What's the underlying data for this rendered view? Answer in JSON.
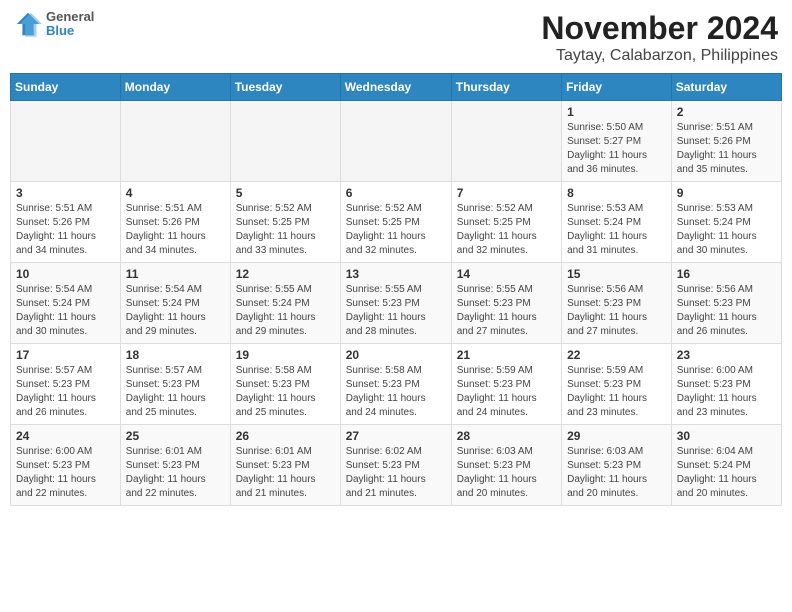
{
  "header": {
    "logo_line1": "General",
    "logo_line2": "Blue",
    "title": "November 2024",
    "subtitle": "Taytay, Calabarzon, Philippines"
  },
  "weekdays": [
    "Sunday",
    "Monday",
    "Tuesday",
    "Wednesday",
    "Thursday",
    "Friday",
    "Saturday"
  ],
  "weeks": [
    [
      {
        "day": "",
        "info": ""
      },
      {
        "day": "",
        "info": ""
      },
      {
        "day": "",
        "info": ""
      },
      {
        "day": "",
        "info": ""
      },
      {
        "day": "",
        "info": ""
      },
      {
        "day": "1",
        "info": "Sunrise: 5:50 AM\nSunset: 5:27 PM\nDaylight: 11 hours\nand 36 minutes."
      },
      {
        "day": "2",
        "info": "Sunrise: 5:51 AM\nSunset: 5:26 PM\nDaylight: 11 hours\nand 35 minutes."
      }
    ],
    [
      {
        "day": "3",
        "info": "Sunrise: 5:51 AM\nSunset: 5:26 PM\nDaylight: 11 hours\nand 34 minutes."
      },
      {
        "day": "4",
        "info": "Sunrise: 5:51 AM\nSunset: 5:26 PM\nDaylight: 11 hours\nand 34 minutes."
      },
      {
        "day": "5",
        "info": "Sunrise: 5:52 AM\nSunset: 5:25 PM\nDaylight: 11 hours\nand 33 minutes."
      },
      {
        "day": "6",
        "info": "Sunrise: 5:52 AM\nSunset: 5:25 PM\nDaylight: 11 hours\nand 32 minutes."
      },
      {
        "day": "7",
        "info": "Sunrise: 5:52 AM\nSunset: 5:25 PM\nDaylight: 11 hours\nand 32 minutes."
      },
      {
        "day": "8",
        "info": "Sunrise: 5:53 AM\nSunset: 5:24 PM\nDaylight: 11 hours\nand 31 minutes."
      },
      {
        "day": "9",
        "info": "Sunrise: 5:53 AM\nSunset: 5:24 PM\nDaylight: 11 hours\nand 30 minutes."
      }
    ],
    [
      {
        "day": "10",
        "info": "Sunrise: 5:54 AM\nSunset: 5:24 PM\nDaylight: 11 hours\nand 30 minutes."
      },
      {
        "day": "11",
        "info": "Sunrise: 5:54 AM\nSunset: 5:24 PM\nDaylight: 11 hours\nand 29 minutes."
      },
      {
        "day": "12",
        "info": "Sunrise: 5:55 AM\nSunset: 5:24 PM\nDaylight: 11 hours\nand 29 minutes."
      },
      {
        "day": "13",
        "info": "Sunrise: 5:55 AM\nSunset: 5:23 PM\nDaylight: 11 hours\nand 28 minutes."
      },
      {
        "day": "14",
        "info": "Sunrise: 5:55 AM\nSunset: 5:23 PM\nDaylight: 11 hours\nand 27 minutes."
      },
      {
        "day": "15",
        "info": "Sunrise: 5:56 AM\nSunset: 5:23 PM\nDaylight: 11 hours\nand 27 minutes."
      },
      {
        "day": "16",
        "info": "Sunrise: 5:56 AM\nSunset: 5:23 PM\nDaylight: 11 hours\nand 26 minutes."
      }
    ],
    [
      {
        "day": "17",
        "info": "Sunrise: 5:57 AM\nSunset: 5:23 PM\nDaylight: 11 hours\nand 26 minutes."
      },
      {
        "day": "18",
        "info": "Sunrise: 5:57 AM\nSunset: 5:23 PM\nDaylight: 11 hours\nand 25 minutes."
      },
      {
        "day": "19",
        "info": "Sunrise: 5:58 AM\nSunset: 5:23 PM\nDaylight: 11 hours\nand 25 minutes."
      },
      {
        "day": "20",
        "info": "Sunrise: 5:58 AM\nSunset: 5:23 PM\nDaylight: 11 hours\nand 24 minutes."
      },
      {
        "day": "21",
        "info": "Sunrise: 5:59 AM\nSunset: 5:23 PM\nDaylight: 11 hours\nand 24 minutes."
      },
      {
        "day": "22",
        "info": "Sunrise: 5:59 AM\nSunset: 5:23 PM\nDaylight: 11 hours\nand 23 minutes."
      },
      {
        "day": "23",
        "info": "Sunrise: 6:00 AM\nSunset: 5:23 PM\nDaylight: 11 hours\nand 23 minutes."
      }
    ],
    [
      {
        "day": "24",
        "info": "Sunrise: 6:00 AM\nSunset: 5:23 PM\nDaylight: 11 hours\nand 22 minutes."
      },
      {
        "day": "25",
        "info": "Sunrise: 6:01 AM\nSunset: 5:23 PM\nDaylight: 11 hours\nand 22 minutes."
      },
      {
        "day": "26",
        "info": "Sunrise: 6:01 AM\nSunset: 5:23 PM\nDaylight: 11 hours\nand 21 minutes."
      },
      {
        "day": "27",
        "info": "Sunrise: 6:02 AM\nSunset: 5:23 PM\nDaylight: 11 hours\nand 21 minutes."
      },
      {
        "day": "28",
        "info": "Sunrise: 6:03 AM\nSunset: 5:23 PM\nDaylight: 11 hours\nand 20 minutes."
      },
      {
        "day": "29",
        "info": "Sunrise: 6:03 AM\nSunset: 5:23 PM\nDaylight: 11 hours\nand 20 minutes."
      },
      {
        "day": "30",
        "info": "Sunrise: 6:04 AM\nSunset: 5:24 PM\nDaylight: 11 hours\nand 20 minutes."
      }
    ]
  ]
}
